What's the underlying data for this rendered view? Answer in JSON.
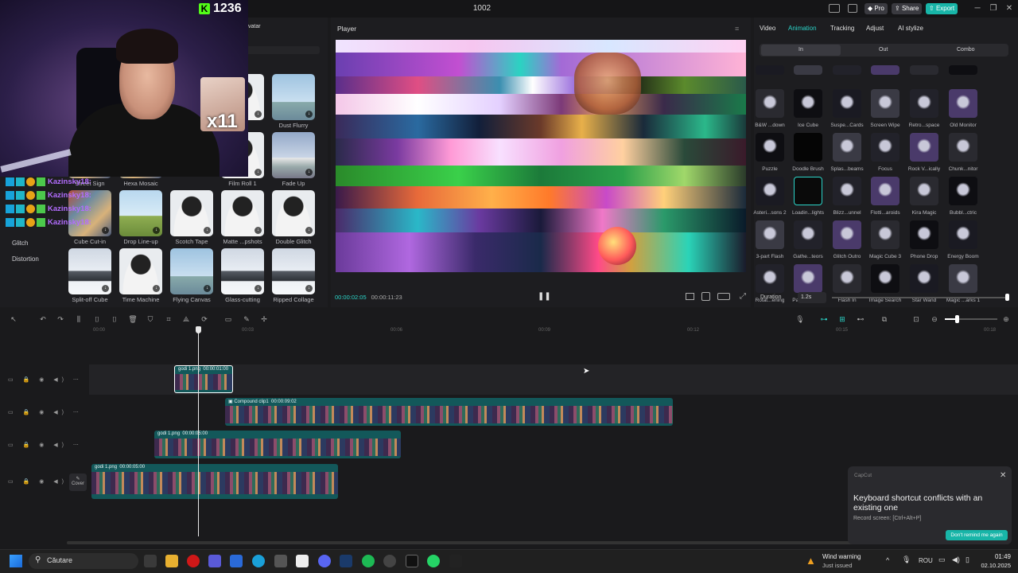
{
  "titlebar": {
    "title": "1002",
    "pro": "Pro",
    "share": "Share",
    "export": "Export",
    "minimize": "─",
    "maximize": "❐",
    "close": "✕"
  },
  "stream": {
    "viewer_count": "1236",
    "gif_text": "x11",
    "chat_names": [
      "Kazinsky18:",
      "Kazinsky18:",
      "Kazinsky18:",
      "Kazinsky18:"
    ]
  },
  "left_panel": {
    "avatar_tab": "vatar",
    "categories": [
      "Glitch",
      "Distortion"
    ],
    "items": [
      {
        "label": "er",
        "kind": "person"
      },
      {
        "label": "Dust Flurry",
        "kind": "tower"
      },
      {
        "label": "Film Roll 1",
        "kind": "person"
      },
      {
        "label": "Fade Up",
        "kind": "car"
      },
      {
        "label": "Street Sign",
        "kind": "crowd"
      },
      {
        "label": "Hexa Mosaic",
        "kind": "crowd"
      },
      {
        "label": "Cube Cut-in",
        "kind": "crowd"
      },
      {
        "label": "Drop Line-up",
        "kind": "field"
      },
      {
        "label": "Scotch Tape",
        "kind": "person"
      },
      {
        "label": "Matte ...pshots",
        "kind": "person"
      },
      {
        "label": "Double Glitch",
        "kind": "person"
      },
      {
        "label": "Split-off Cube",
        "kind": "mountain"
      },
      {
        "label": "Time Machine",
        "kind": "person"
      },
      {
        "label": "Flying Canvas",
        "kind": "tower"
      },
      {
        "label": "Glass-cutting",
        "kind": "mountain"
      },
      {
        "label": "Ripped Collage",
        "kind": "mountain"
      }
    ]
  },
  "player": {
    "header": "Player",
    "time_current": "00:00:02:05",
    "time_total": "00:00:11:23"
  },
  "right_panel": {
    "tabs": [
      "Video",
      "Animation",
      "Tracking",
      "Adjust",
      "AI stylize"
    ],
    "active_tab": "Animation",
    "modes": [
      "In",
      "Out",
      "Combo"
    ],
    "rows": [
      [
        "B&W ...down",
        "Ice Cube",
        "Suspe...Cards",
        "Screen Wipe",
        "Retro...space",
        "Old Monitor"
      ],
      [
        "Puzzle",
        "Doodle Brush",
        "Splas...beams",
        "Focus",
        "Rock V...ically",
        "Chunk...nitor"
      ],
      [
        "Asteri...sons 2",
        "Loadin...lights",
        "Blizz...unnel",
        "Flotti...aroids",
        "Kira Magic",
        "Bubbl...ctric"
      ],
      [
        "3-part Flash",
        "Gathe...teors",
        "Glitch Outro",
        "Magic Cube 3",
        "Phone Drop",
        "Energy Boom"
      ],
      [
        "Rotat...ening",
        "Pastel Tunnel",
        "Flash In",
        "Image Search",
        "Star Wand",
        "Magic ...arks 1"
      ]
    ],
    "duration_label": "Duration",
    "duration_value": "1.2s"
  },
  "timeline": {
    "ticks": [
      "00:00",
      "00:03",
      "00:06",
      "00:09",
      "00:12",
      "00:15",
      "00:18"
    ],
    "cover_label": "Cover",
    "clips": [
      {
        "name": "godi 1.png",
        "duration": "00:00:01:00"
      },
      {
        "name": "Compound clip1",
        "duration": "00:00:09:02"
      },
      {
        "name": "godi 1.png",
        "duration": "00:00:05:00"
      },
      {
        "name": "godi 1.png",
        "duration": "00:00:05:00"
      }
    ]
  },
  "toast": {
    "brand": "CapCut",
    "message": "Keyboard shortcut conflicts with an existing one",
    "sub": "Record screen: [Ctrl+Alt+P]",
    "button": "Don't remind me again"
  },
  "taskbar": {
    "search": "Căutare",
    "weather_title": "Wind warning",
    "weather_sub": "Just issued",
    "lang": "ROU",
    "time": "01:49",
    "date": "02.10.2025"
  }
}
